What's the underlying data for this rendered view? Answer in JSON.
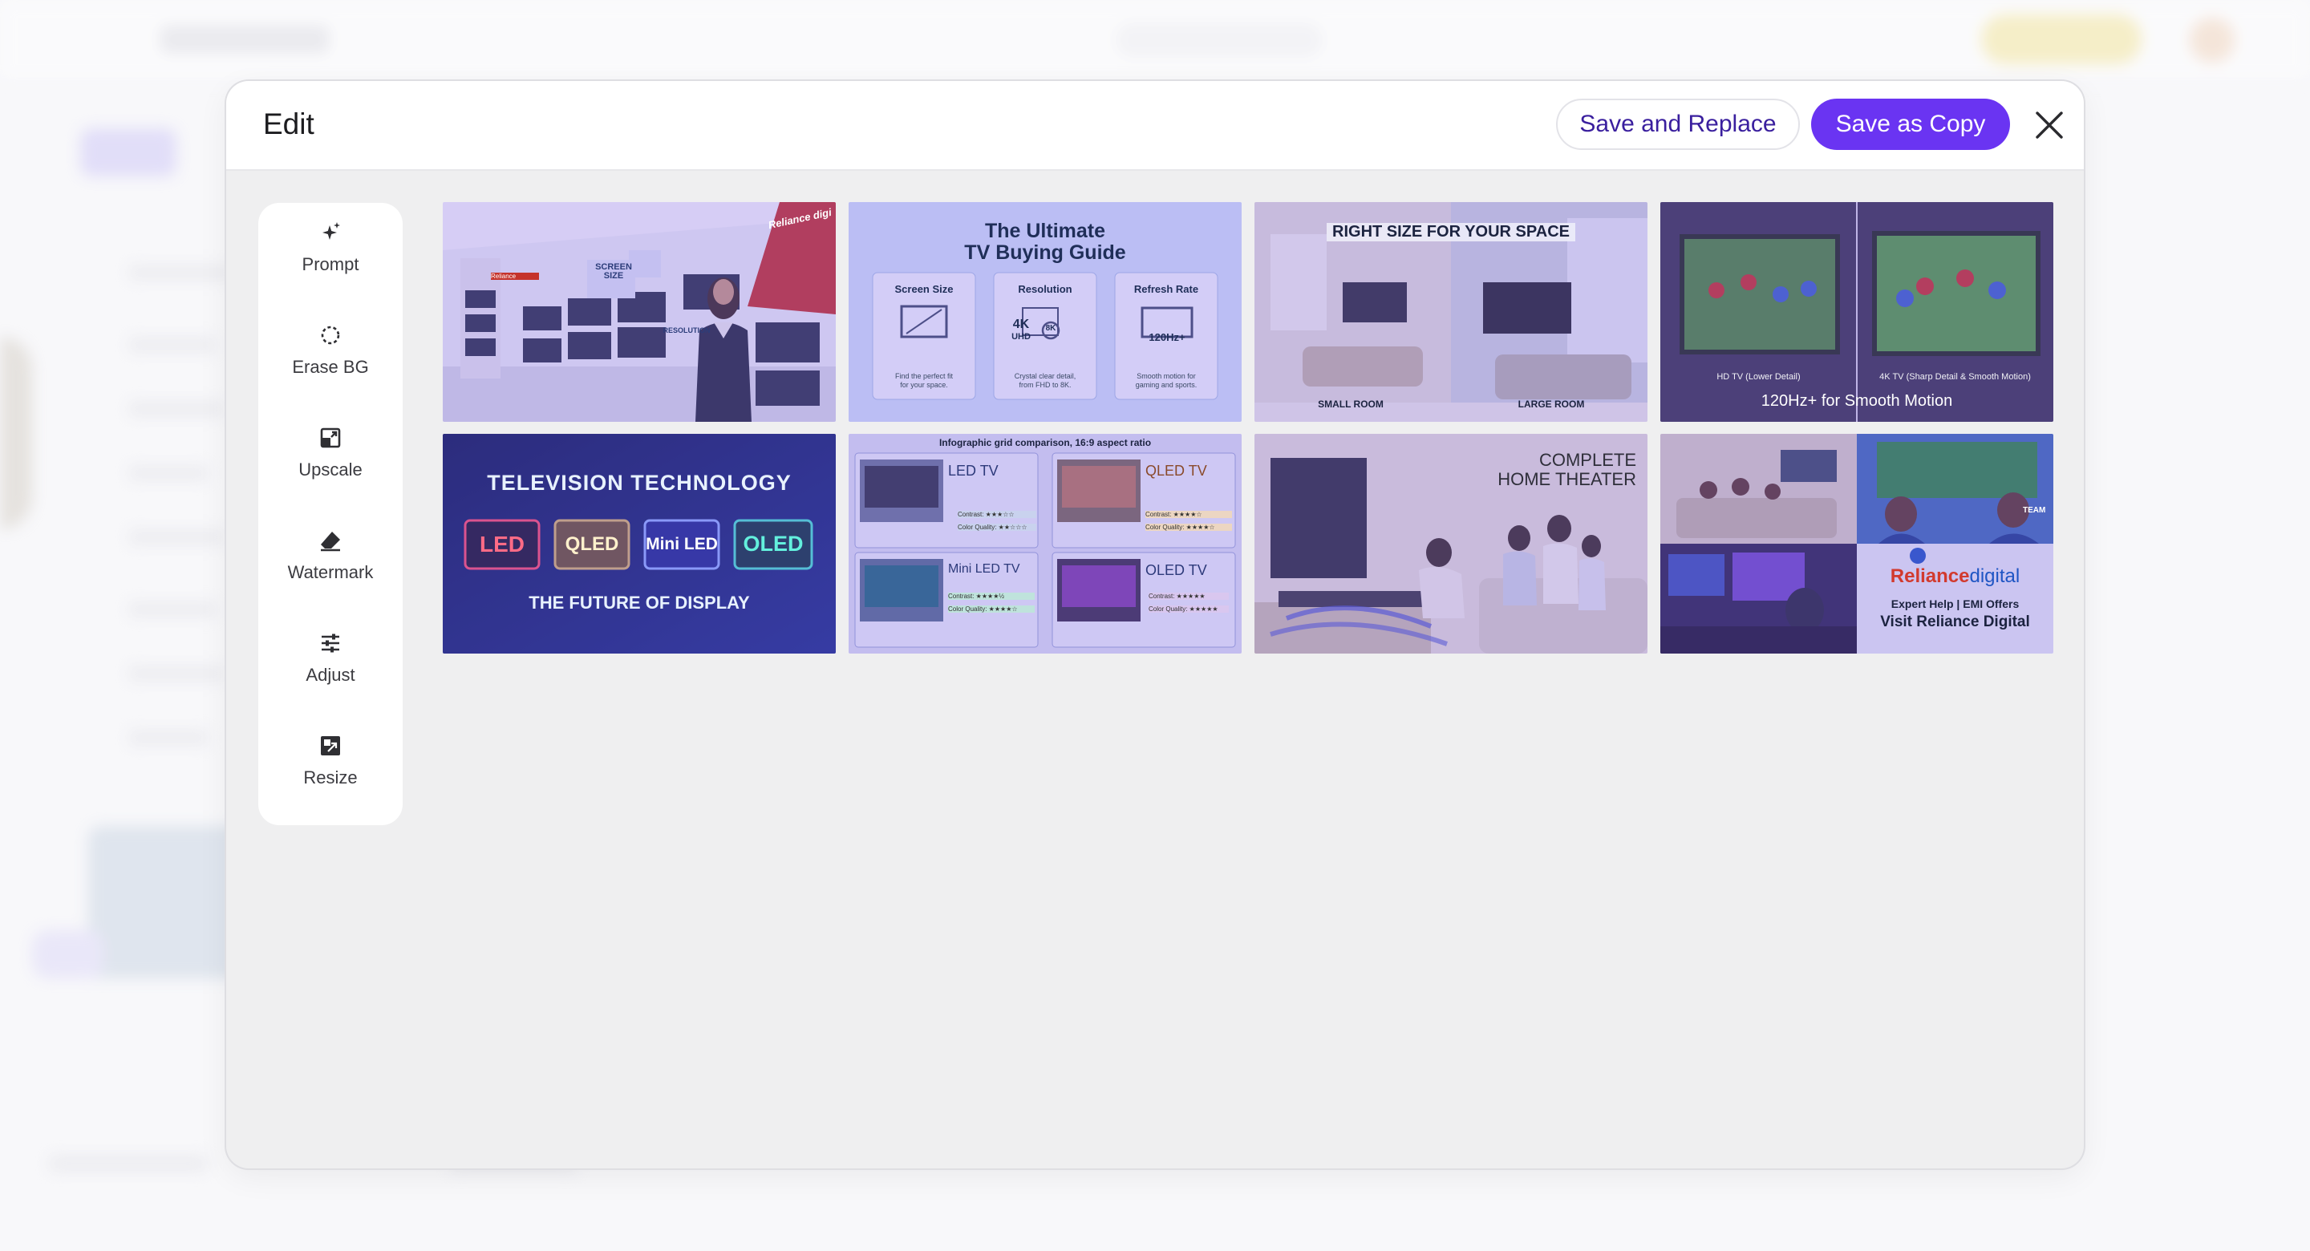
{
  "modal": {
    "title": "Edit",
    "save_replace_label": "Save and Replace",
    "save_copy_label": "Save as Copy",
    "close_icon": "close-icon"
  },
  "tools": [
    {
      "label": "Prompt",
      "icon": "sparkle-icon"
    },
    {
      "label": "Erase BG",
      "icon": "erase-bg-icon"
    },
    {
      "label": "Upscale",
      "icon": "upscale-icon"
    },
    {
      "label": "Watermark",
      "icon": "eraser-icon"
    },
    {
      "label": "Adjust",
      "icon": "sliders-icon"
    },
    {
      "label": "Resize",
      "icon": "resize-icon"
    }
  ],
  "thumbnails": {
    "t1": {
      "sign_left": "Reliance",
      "sign_right": "Reliance digi",
      "banner_1": "SCREEN SIZE",
      "banner_2": "RESOLUTION"
    },
    "t2": {
      "title_1": "The Ultimate",
      "title_2": "TV Buying Guide",
      "cols": [
        {
          "head": "Screen Size",
          "cap_1": "Find the perfect fit",
          "cap_2": "for your space."
        },
        {
          "head": "Resolution",
          "cap_1": "Crystal clear detail,",
          "cap_2": "from FHD to 8K.",
          "badge_1": "4K",
          "badge_2": "UHD",
          "badge_3": "8K"
        },
        {
          "head": "Refresh Rate",
          "cap_1": "Smooth motion for",
          "cap_2": "gaming and sports.",
          "badge": "120Hz+"
        }
      ]
    },
    "t3": {
      "title": "RIGHT SIZE FOR YOUR SPACE",
      "left": "SMALL ROOM",
      "right": "LARGE ROOM"
    },
    "t4": {
      "left": "HD TV (Lower Detail)",
      "right": "4K TV (Sharp Detail & Smooth Motion)",
      "caption": "120Hz+ for Smooth Motion"
    },
    "t5": {
      "title": "TELEVISION TECHNOLOGY",
      "chips": [
        "LED",
        "QLED",
        "Mini LED",
        "OLED"
      ],
      "subtitle": "THE FUTURE OF DISPLAY"
    },
    "t6": {
      "header": "Infographic grid comparison, 16:9 aspect ratio",
      "cells": [
        {
          "name": "LED TV",
          "r1": "Contrast: ★★★☆☆",
          "r2": "Color Quality: ★★☆☆☆"
        },
        {
          "name": "QLED TV",
          "r1": "Contrast: ★★★★☆",
          "r2": "Color Quality: ★★★★☆"
        },
        {
          "name": "Mini LED TV",
          "r1": "Contrast: ★★★★½",
          "r2": "Color Quality: ★★★★☆"
        },
        {
          "name": "OLED TV",
          "r1": "Contrast: ★★★★★",
          "r2": "Color Quality: ★★★★★"
        }
      ]
    },
    "t7": {
      "line_1": "COMPLETE",
      "line_2": "HOME THEATER"
    },
    "t8": {
      "brand_1": "Reliance",
      "brand_2": "digital",
      "line_1": "Expert Help | EMI Offers",
      "line_2": "Visit Reliance Digital",
      "jersey": "TEAM"
    }
  },
  "colors": {
    "accent": "#6a34f2",
    "accent_text": "#3a1f9e",
    "modal_bg": "#efeff0"
  }
}
